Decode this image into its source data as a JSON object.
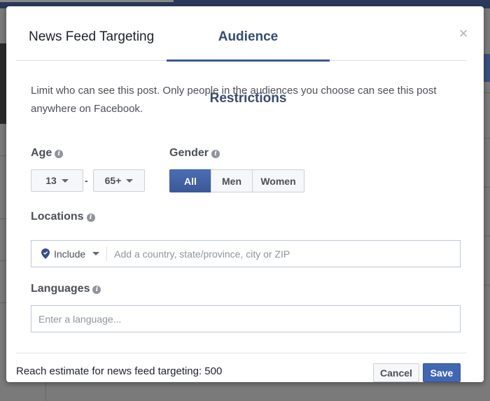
{
  "tabs": [
    {
      "label": "News Feed Targeting",
      "active": false
    },
    {
      "label": "Audience Restrictions",
      "active": true
    }
  ],
  "close_icon": "×",
  "description": "Limit who can see this post. Only people in the audiences you choose can see this post anywhere on Facebook.",
  "age": {
    "label": "Age",
    "info_icon": "i",
    "min_value": "13",
    "separator": "-",
    "max_value": "65+"
  },
  "gender": {
    "label": "Gender",
    "info_icon": "i",
    "options": [
      {
        "label": "All",
        "selected": true
      },
      {
        "label": "Men",
        "selected": false
      },
      {
        "label": "Women",
        "selected": false
      }
    ]
  },
  "locations": {
    "label": "Locations",
    "info_icon": "i",
    "mode": "Include",
    "value": "",
    "placeholder": "Add a country, state/province, city or ZIP"
  },
  "languages": {
    "label": "Languages",
    "info_icon": "i",
    "value": "",
    "placeholder": "Enter a language..."
  },
  "footer": {
    "reach_text": "Reach estimate for news feed targeting: 500",
    "cancel_label": "Cancel",
    "save_label": "Save"
  },
  "colors": {
    "accent": "#3b5998",
    "button_primary": "#4267b2"
  }
}
